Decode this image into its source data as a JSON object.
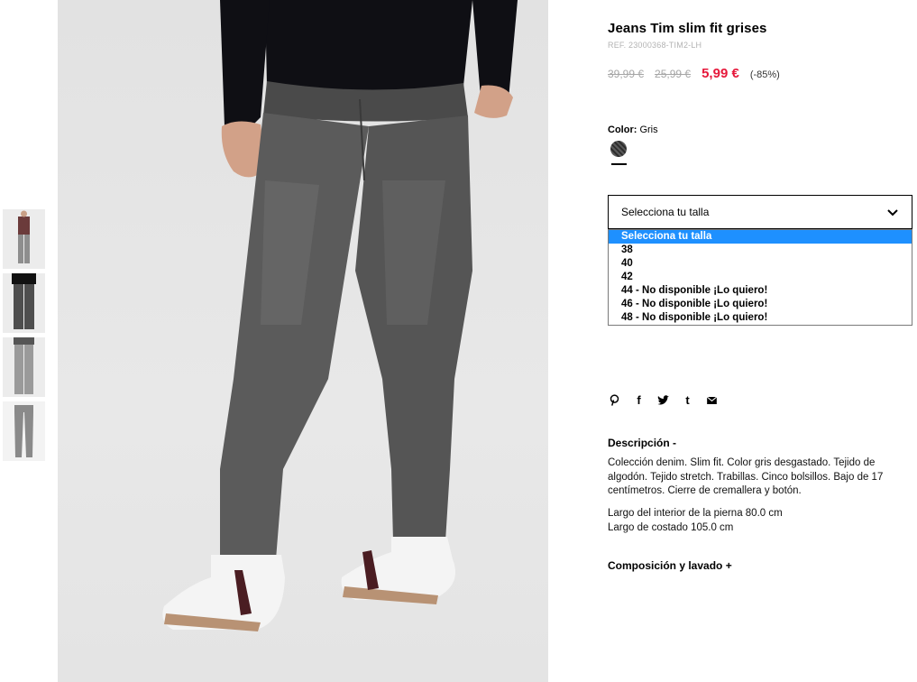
{
  "product": {
    "title": "Jeans Tim slim fit grises",
    "ref": "REF. 23000368-TIM2-LH",
    "price_original": "39,99 €",
    "price_previous": "25,99 €",
    "price_current": "5,99 €",
    "discount": "(-85%)"
  },
  "color": {
    "label": "Color:",
    "value": "Gris"
  },
  "size_select": {
    "selected": "Selecciona tu talla",
    "options": [
      "Selecciona tu talla",
      "38",
      "40",
      "42",
      "44 - No disponible ¡Lo quiero!",
      "46 - No disponible ¡Lo quiero!",
      "48 - No disponible ¡Lo quiero!"
    ]
  },
  "share": {
    "pinterest": "P",
    "facebook": "f",
    "twitter": "t",
    "tumblr": "t",
    "email": "✉"
  },
  "description": {
    "heading": "Descripción -",
    "text": "Colección denim. Slim fit. Color gris desgastado. Tejido de algodón. Tejido stretch. Trabillas. Cinco bolsillos. Bajo de 17 centímetros. Cierre de cremallera y botón.",
    "inseam": "Largo del interior de la pierna 80.0 cm",
    "side": "Largo de costado 105.0 cm"
  },
  "composition": {
    "heading": "Composición y lavado +"
  },
  "colors": {
    "sale": "#e6173a",
    "highlight": "#1e90ff"
  }
}
